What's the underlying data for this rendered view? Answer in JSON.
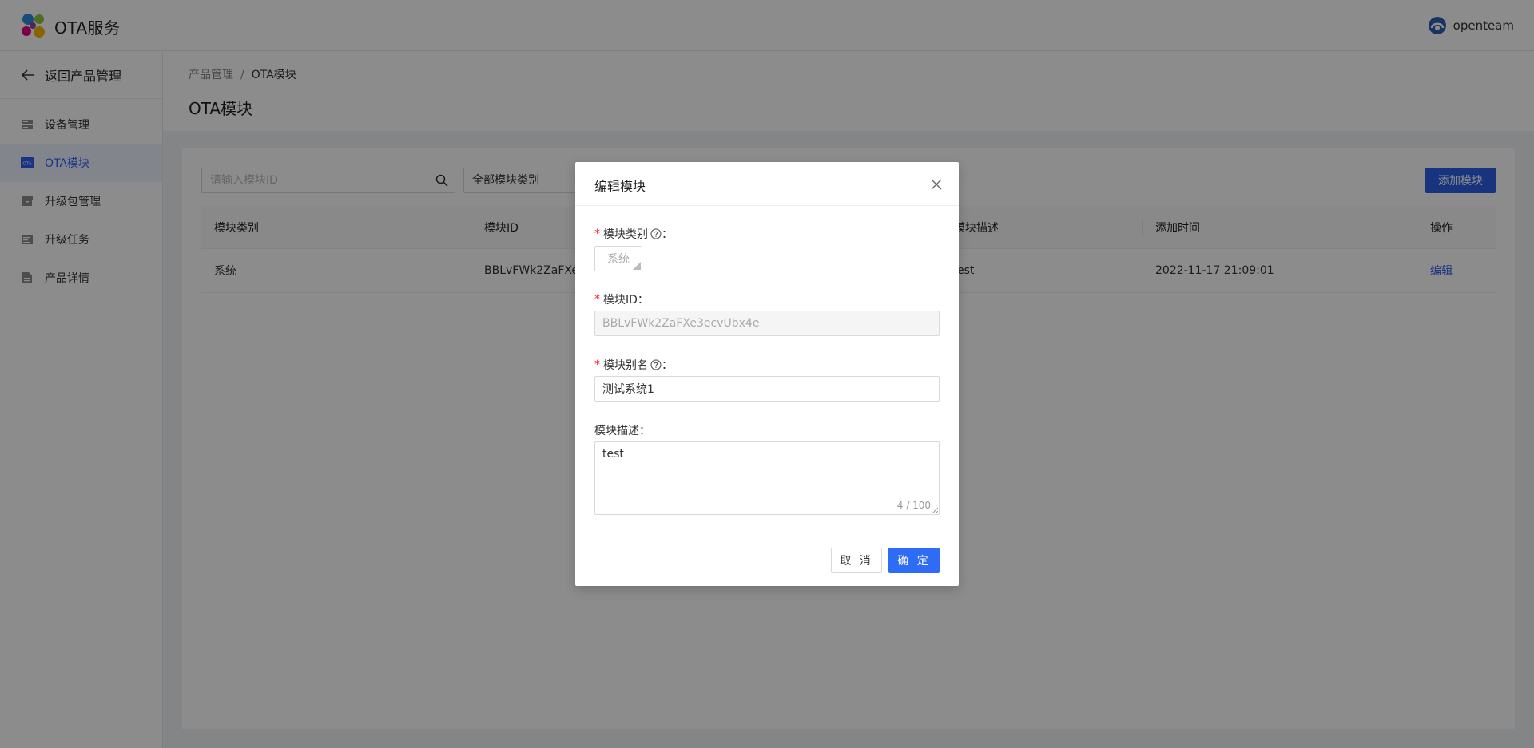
{
  "app": {
    "title": "OTA服务",
    "user": "openteam"
  },
  "sidebar": {
    "back_label": "返回产品管理",
    "items": [
      {
        "label": "设备管理",
        "icon": "device-list-icon",
        "active": false
      },
      {
        "label": "OTA模块",
        "icon": "ota-icon",
        "active": true
      },
      {
        "label": "升级包管理",
        "icon": "package-icon",
        "active": false
      },
      {
        "label": "升级任务",
        "icon": "task-icon",
        "active": false
      },
      {
        "label": "产品详情",
        "icon": "document-icon",
        "active": false
      }
    ],
    "ota_icon_text": "OTA"
  },
  "breadcrumb": {
    "parent": "产品管理",
    "separator": "/",
    "current": "OTA模块"
  },
  "page": {
    "title": "OTA模块"
  },
  "toolbar": {
    "search_placeholder": "请输入模块ID",
    "type_filter": "全部模块类别",
    "add_label": "添加模块"
  },
  "table": {
    "headers": [
      "模块类别",
      "模块ID",
      "模块描述",
      "添加时间",
      "操作"
    ],
    "rows": [
      {
        "type": "系统",
        "id": "BBLvFWk2ZaFXe3",
        "desc": "est",
        "time": "2022-11-17 21:09:01",
        "action": "编辑"
      }
    ]
  },
  "modal": {
    "title": "编辑模块",
    "type_label": "模块类别",
    "type_value": "系统",
    "id_label": "模块ID：",
    "id_value": "BBLvFWk2ZaFXe3ecvUbx4e",
    "alias_label": "模块别名",
    "alias_value": "测试系统1",
    "desc_label": "模块描述：",
    "desc_value": "test",
    "desc_counter": "4 / 100",
    "colon": "：",
    "cancel_label": "取 消",
    "ok_label": "确 定"
  },
  "colors": {
    "primary": "#2f5fe8",
    "required": "#f5222d",
    "active_bg": "#eef3ff"
  }
}
